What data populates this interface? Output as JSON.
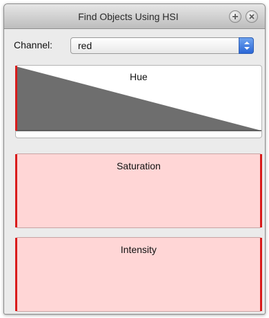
{
  "window": {
    "title": "Find Objects Using HSI",
    "buttons": [
      "zoom-icon",
      "close-icon"
    ]
  },
  "channel": {
    "label": "Channel:",
    "value": "red"
  },
  "panels": {
    "hue": "Hue",
    "saturation": "Saturation",
    "intensity": "Intensity"
  },
  "colors": {
    "hue_fill": "#6e6e6e",
    "range_fill": "#ffd6d6",
    "edge_handle": "#d81b1b",
    "select_arrow": "#2a66d6"
  }
}
